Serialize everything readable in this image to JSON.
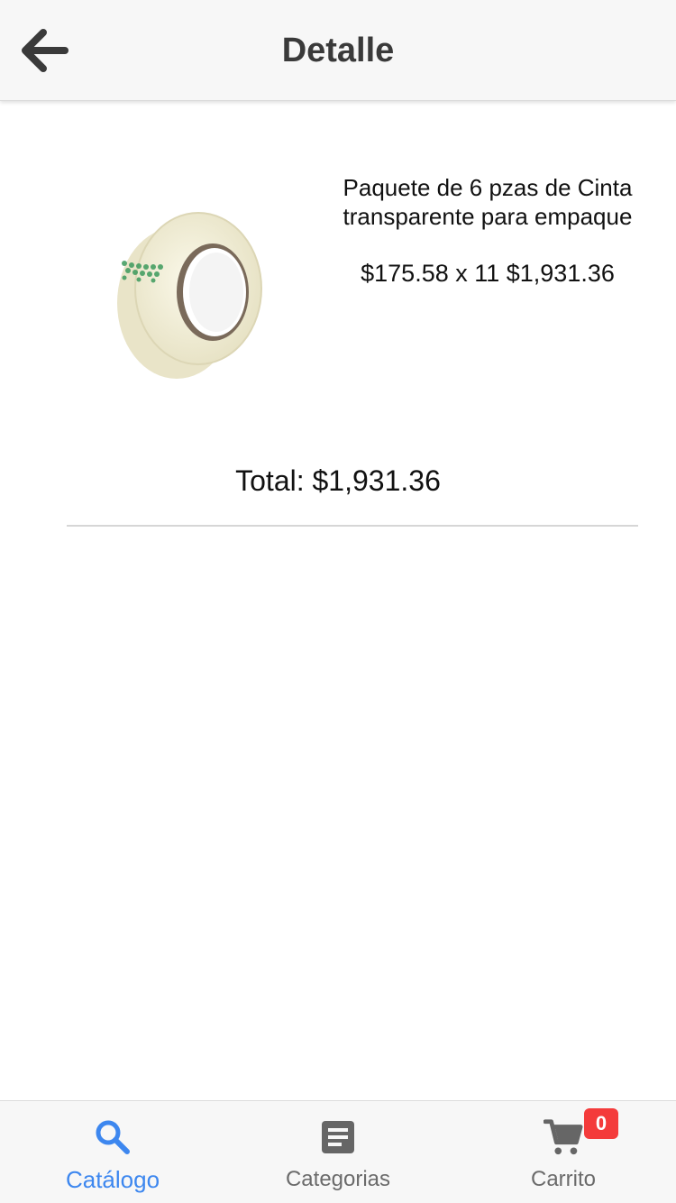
{
  "header": {
    "title": "Detalle",
    "back_icon": "arrow-left-icon"
  },
  "product": {
    "name": "Paquete de 6 pzas de Cinta transparente para empaque",
    "price_line": "$175.58 x 11 $1,931.36",
    "image": "packing-tape-roll-image"
  },
  "summary": {
    "total": "Total: $1,931.36"
  },
  "tabbar": {
    "tabs": [
      {
        "label": "Catálogo",
        "icon": "search-icon",
        "active": true
      },
      {
        "label": "Categorias",
        "icon": "document-list-icon",
        "active": false
      },
      {
        "label": "Carrito",
        "icon": "cart-icon",
        "active": false,
        "badge": "0"
      }
    ]
  },
  "colors": {
    "accent": "#3d87ef",
    "badge": "#f43b3b",
    "header_bg": "#f7f7f7"
  }
}
